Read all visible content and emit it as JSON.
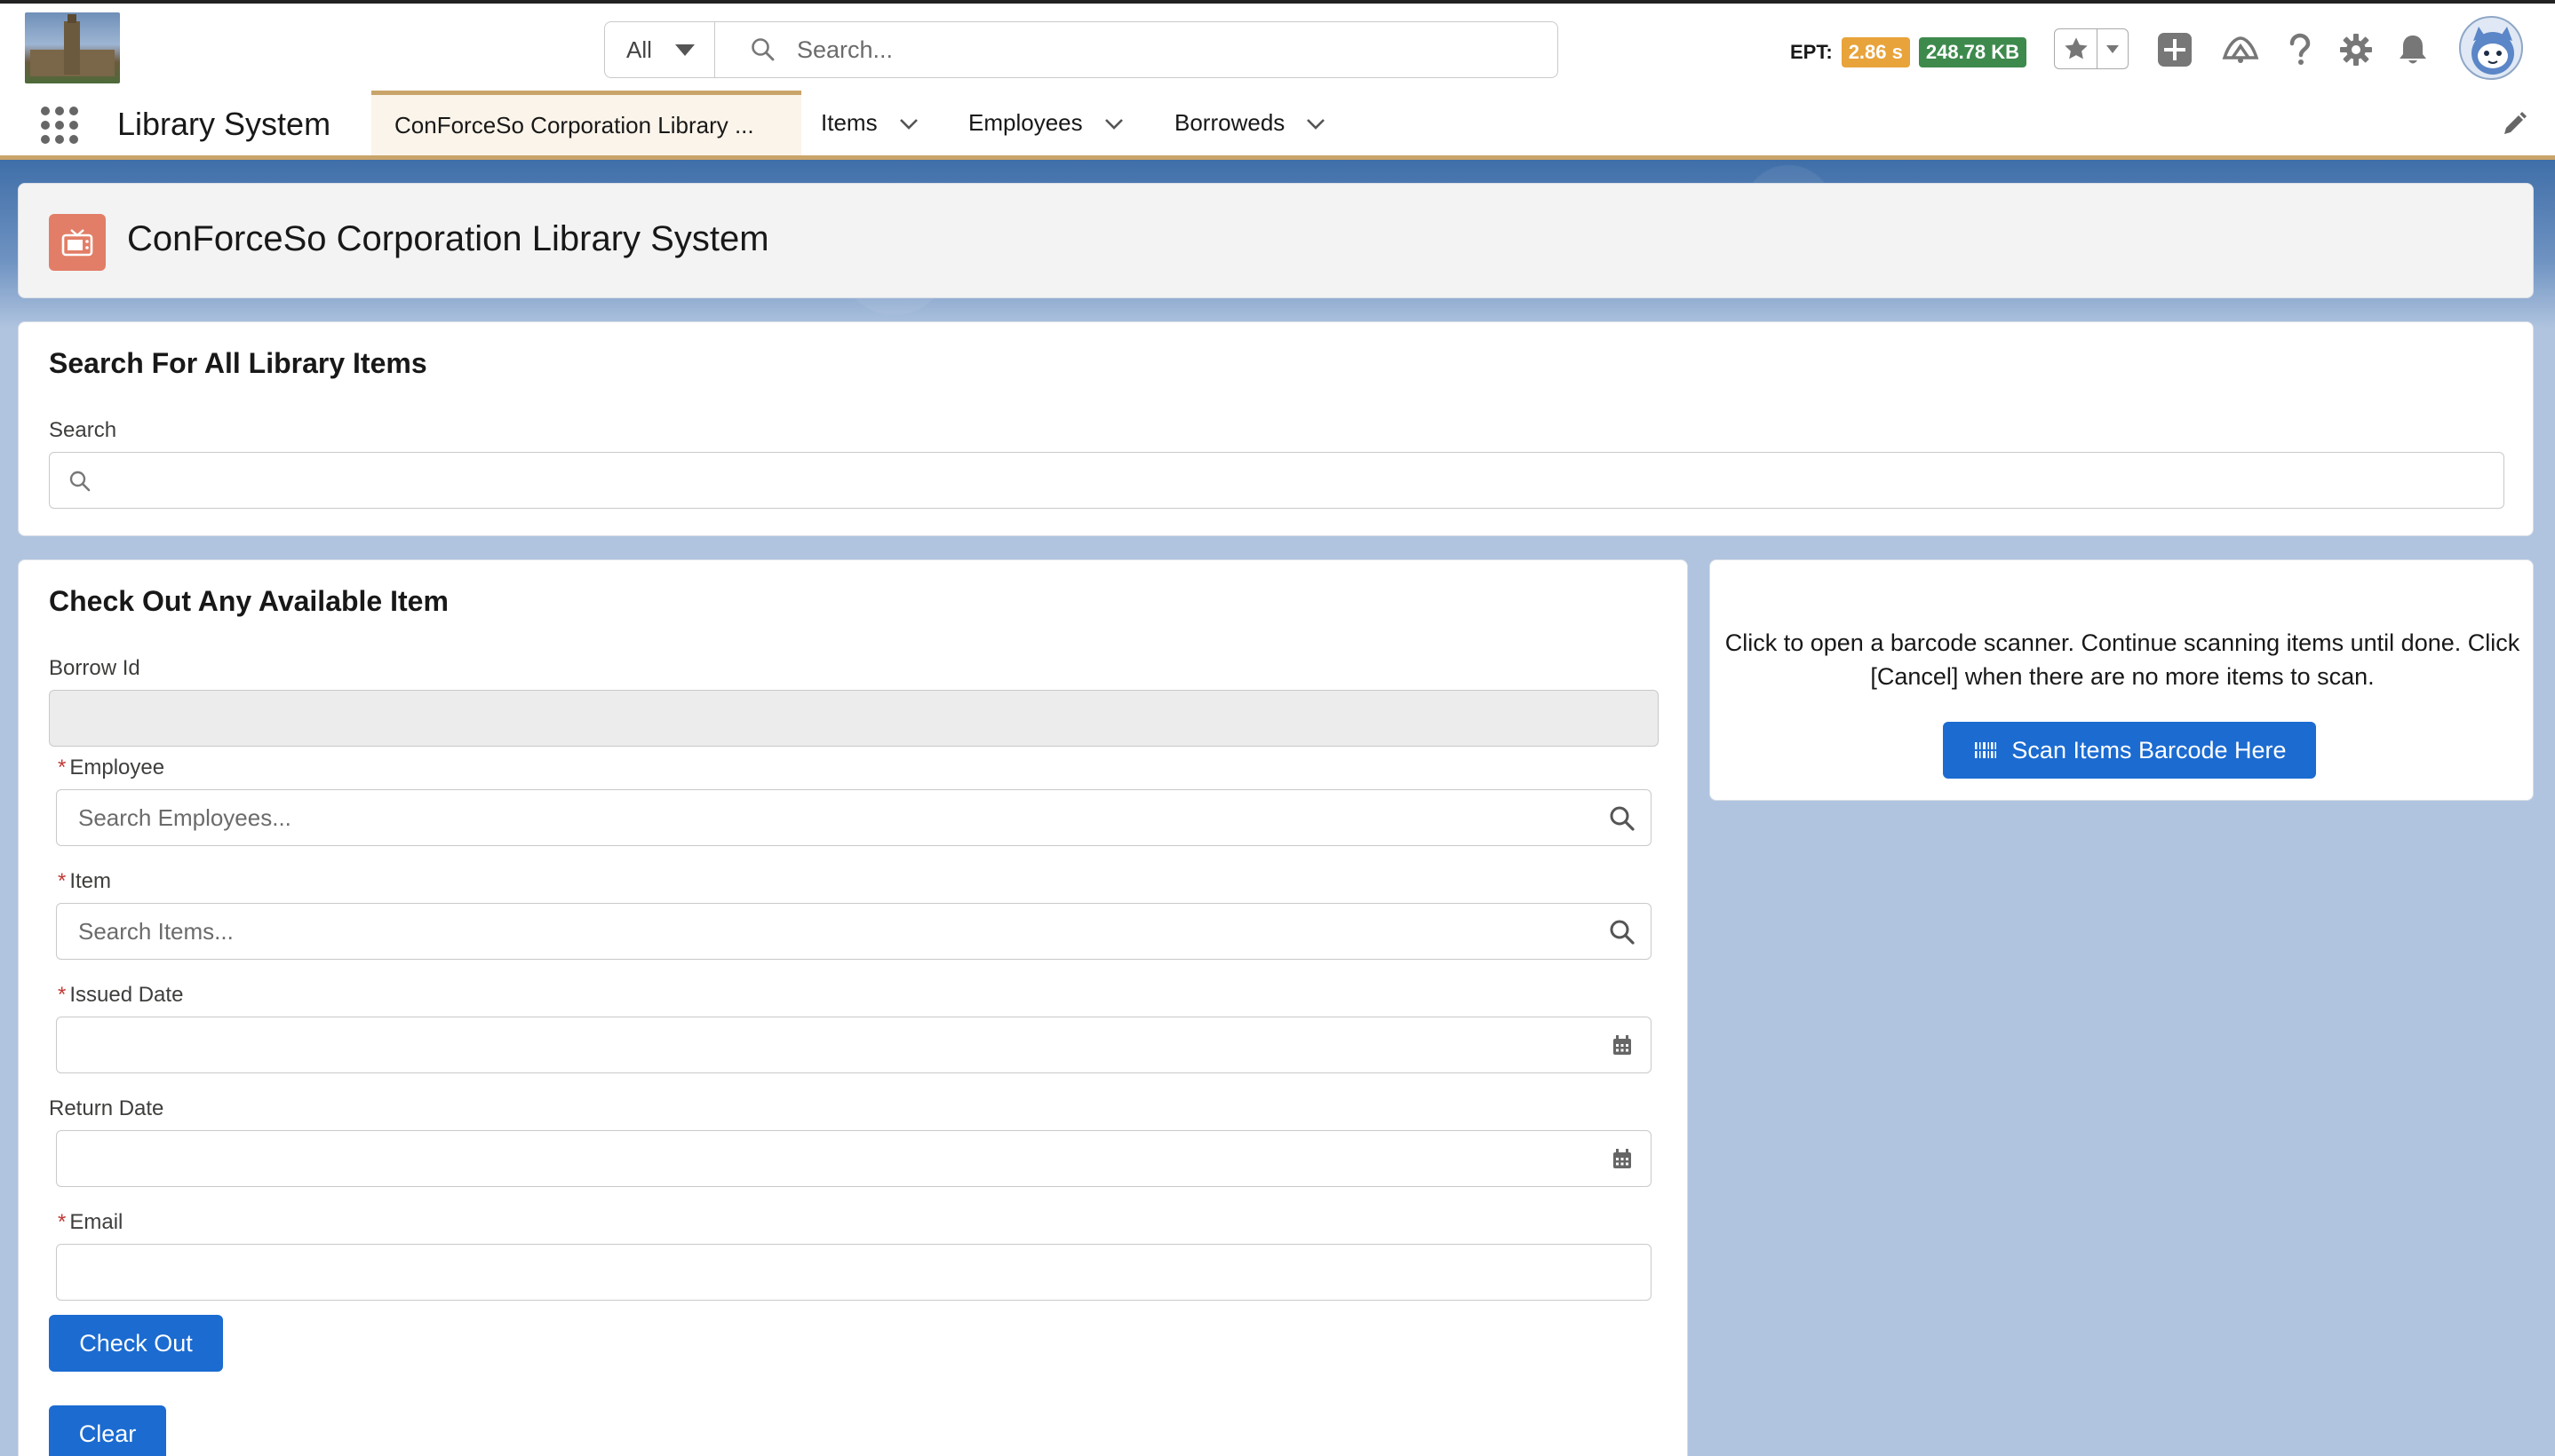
{
  "global_header": {
    "search_scope": "All",
    "search_placeholder": "Search...",
    "ept_label": "EPT:",
    "ept_time": "2.86 s",
    "ept_size": "248.78 KB"
  },
  "nav": {
    "app_name": "Library System",
    "tabs": [
      {
        "label": "ConForceSo Corporation Library ...",
        "active": true
      },
      {
        "label": "Items"
      },
      {
        "label": "Employees"
      },
      {
        "label": "Borroweds"
      }
    ]
  },
  "page_header": {
    "title": "ConForceSo Corporation Library System"
  },
  "search_section": {
    "title": "Search For All Library Items",
    "label": "Search",
    "value": ""
  },
  "checkout": {
    "title": "Check Out Any Available Item",
    "fields": {
      "borrow_id": {
        "label": "Borrow Id",
        "value": ""
      },
      "employee": {
        "label": "Employee",
        "placeholder": "Search Employees..."
      },
      "item": {
        "label": "Item",
        "placeholder": "Search Items..."
      },
      "issued_date": {
        "label": "Issued Date",
        "value": ""
      },
      "return_date": {
        "label": "Return Date",
        "value": ""
      },
      "email": {
        "label": "Email",
        "value": ""
      }
    },
    "required_marker": "*",
    "checkout_button": "Check Out",
    "clear_button": "Clear"
  },
  "scanner": {
    "instructions": "Click to open a barcode scanner. Continue scanning items until done. Click [Cancel] when there are no more items to scan.",
    "button_label": "Scan Items Barcode Here"
  },
  "colors": {
    "brand": "#1b6bd1",
    "nav_accent": "#c9a46a",
    "page_bg": "#b0c4df",
    "ept_time_badge": "#e8a33b",
    "ept_size_badge": "#3e8a4d",
    "page_icon": "#e27e67",
    "required": "#c23934"
  },
  "icons": [
    "search-icon",
    "caret-down-icon",
    "star-icon",
    "add-icon",
    "trailhead-icon",
    "help-icon",
    "gear-icon",
    "bell-icon",
    "avatar",
    "app-launcher-icon",
    "chevron-down-icon",
    "edit-icon",
    "tv-icon",
    "calendar-icon",
    "barcode-icon"
  ]
}
